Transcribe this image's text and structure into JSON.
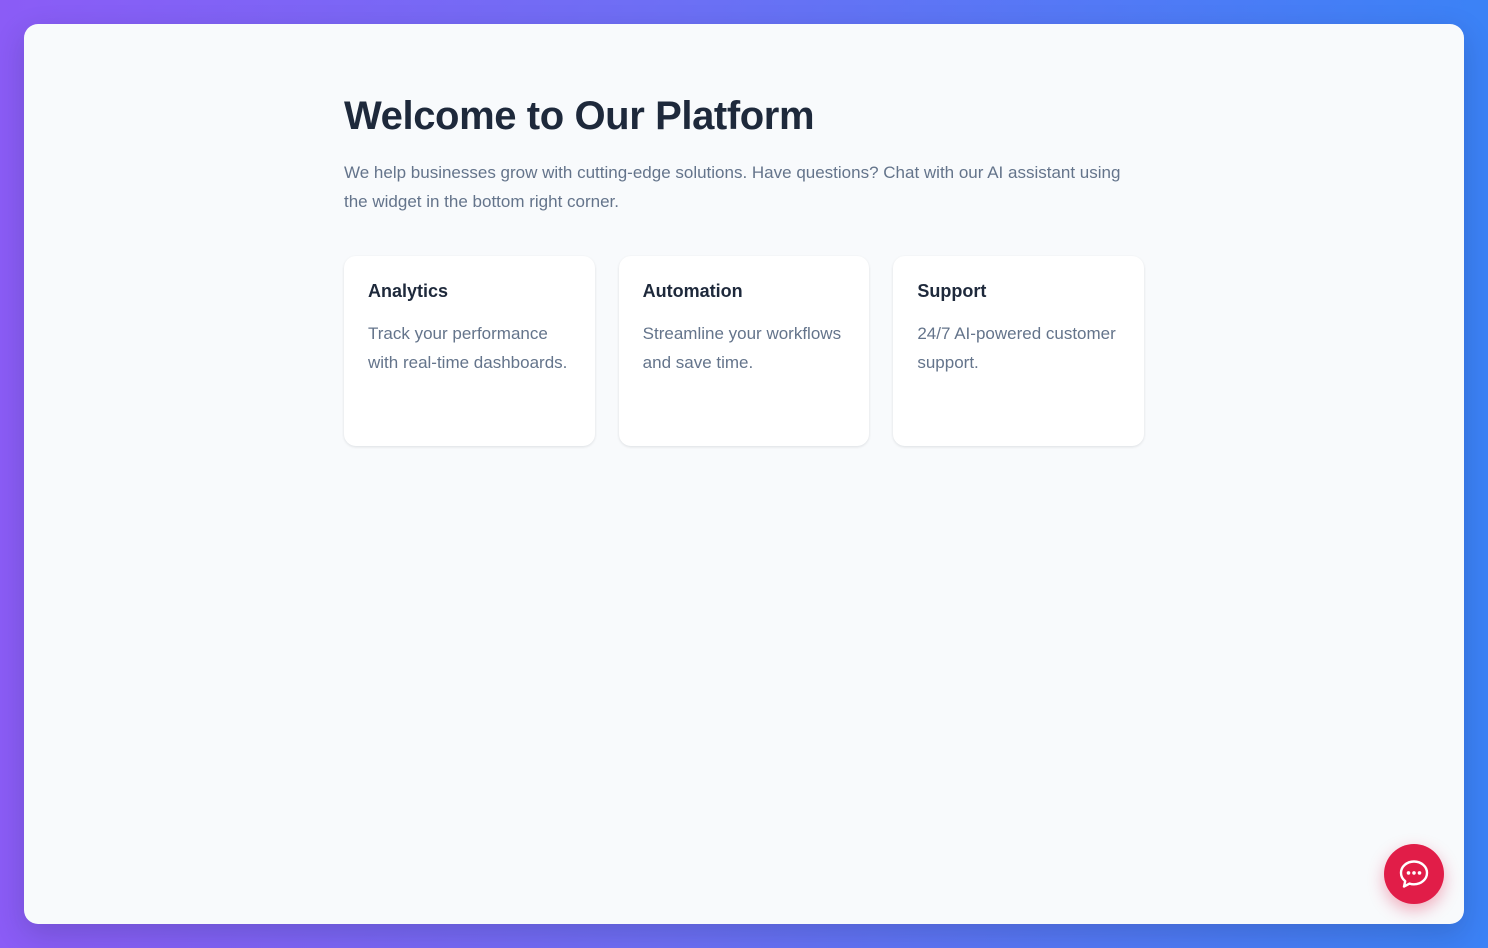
{
  "header": {
    "title": "Welcome to Our Platform",
    "intro": "We help businesses grow with cutting-edge solutions. Have questions? Chat with our AI assistant using the widget in the bottom right corner."
  },
  "features": [
    {
      "title": "Analytics",
      "description": "Track your performance with real-time dashboards."
    },
    {
      "title": "Automation",
      "description": "Streamline your workflows and save time."
    },
    {
      "title": "Support",
      "description": "24/7 AI-powered customer support."
    }
  ],
  "chat_widget": {
    "icon": "chat-bubble-icon",
    "color": "#e11d48"
  },
  "colors": {
    "title": "#1e293b",
    "body_text": "#64748b",
    "page_background": "#f8fafc",
    "gradient_start": "#8b5cf6",
    "gradient_end": "#3b82f6"
  }
}
